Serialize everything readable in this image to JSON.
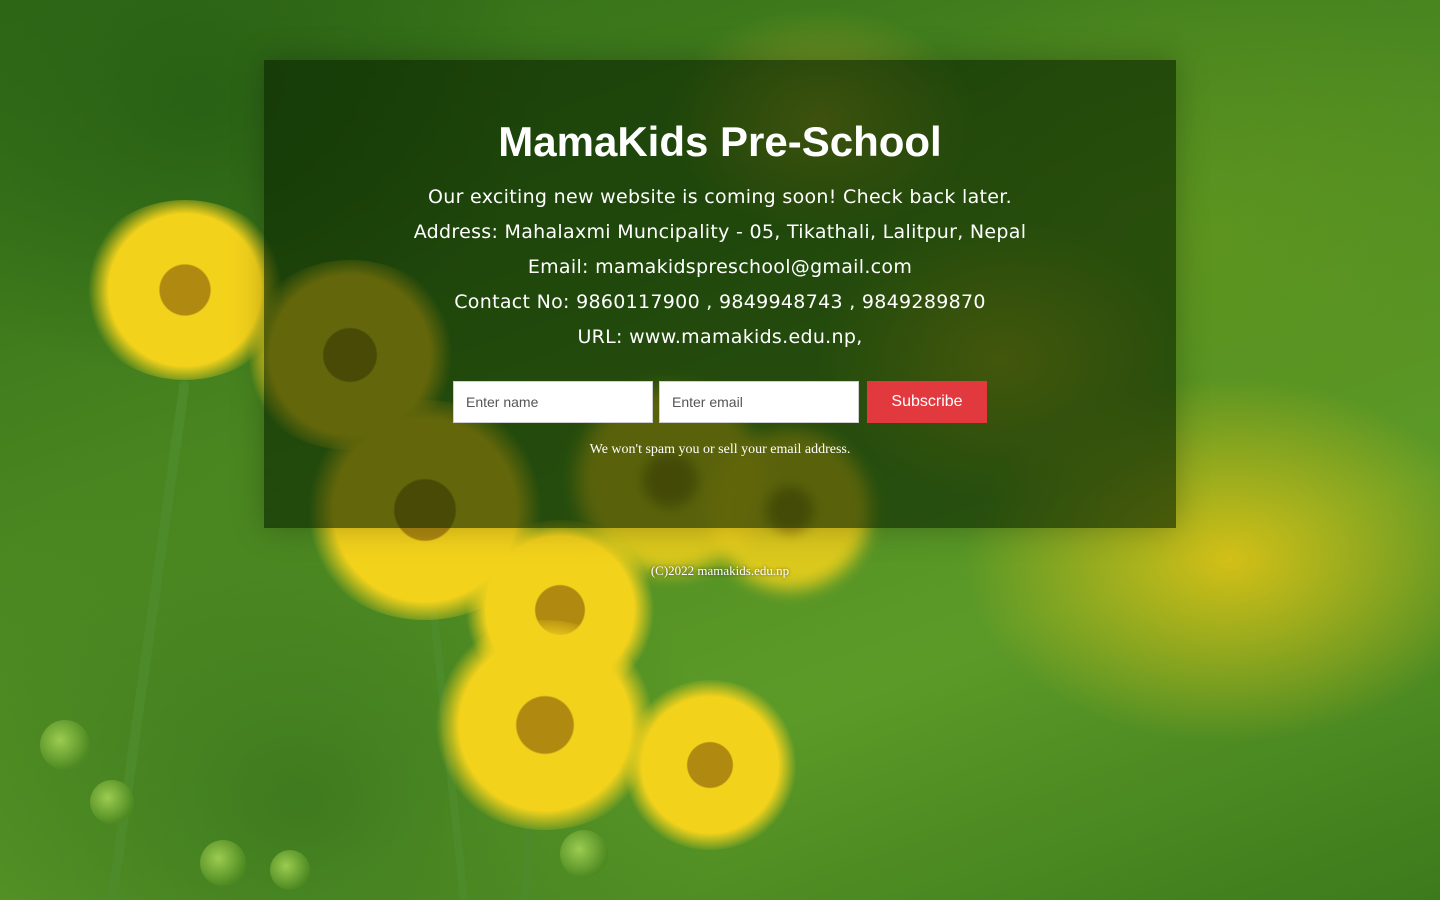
{
  "page": {
    "title": "MamaKids Pre-School",
    "info_lines": [
      "Our exciting new website is coming soon! Check back later.",
      "Address: Mahalaxmi Muncipality - 05, Tikathali, Lalitpur, Nepal",
      "Email: mamakidspreschool@gmail.com",
      "Contact No: 9860117900 , 9849948743 , 9849289870",
      "URL: www.mamakids.edu.np,"
    ]
  },
  "form": {
    "name_placeholder": "Enter name",
    "email_placeholder": "Enter email",
    "subscribe_label": "Subscribe",
    "note": "We won't spam you or sell your email address."
  },
  "footer": {
    "copyright": "(C)2022 mamakids.edu.np"
  },
  "colors": {
    "panel_overlay": "#0a2300",
    "button": "#e2393f",
    "text": "#ffffff"
  }
}
